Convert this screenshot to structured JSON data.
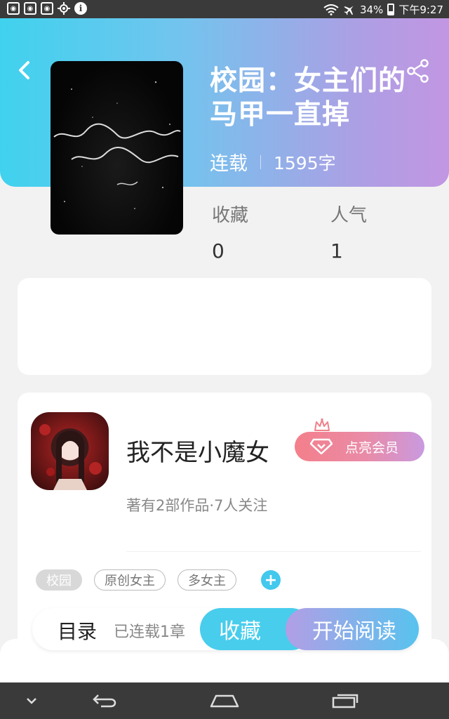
{
  "status_bar": {
    "battery": "34%",
    "time": "下午9:27",
    "icons": [
      "notification-icon",
      "notification-icon",
      "notification-icon",
      "location-icon",
      "info-icon",
      "wifi-icon",
      "airplane-icon",
      "battery-icon"
    ]
  },
  "header": {
    "back_icon": "back-chevron-icon",
    "share_icon": "share-icon",
    "accent_gradient": [
      "#3fd2ee",
      "#c296e2"
    ]
  },
  "book": {
    "title": "校园：女主们的马甲一直掉",
    "status": "连载",
    "word_count": "1595字",
    "stats": [
      {
        "label": "收藏",
        "value": "0"
      },
      {
        "label": "人气",
        "value": "1"
      }
    ]
  },
  "author": {
    "name": "我不是小魔女",
    "vip_label": "点亮会员",
    "meta": "著有2部作品·7人关注"
  },
  "tags": [
    {
      "label": "校园",
      "active": true
    },
    {
      "label": "原创女主",
      "active": false
    },
    {
      "label": "多女主",
      "active": false
    }
  ],
  "actions": {
    "toc_label": "目录",
    "toc_sub": "已连载1章",
    "collect_label": "收藏",
    "read_label": "开始阅读"
  },
  "nav_bar": {
    "icons": [
      "hide-keyboard-icon",
      "back-icon",
      "home-icon",
      "recents-icon"
    ]
  }
}
